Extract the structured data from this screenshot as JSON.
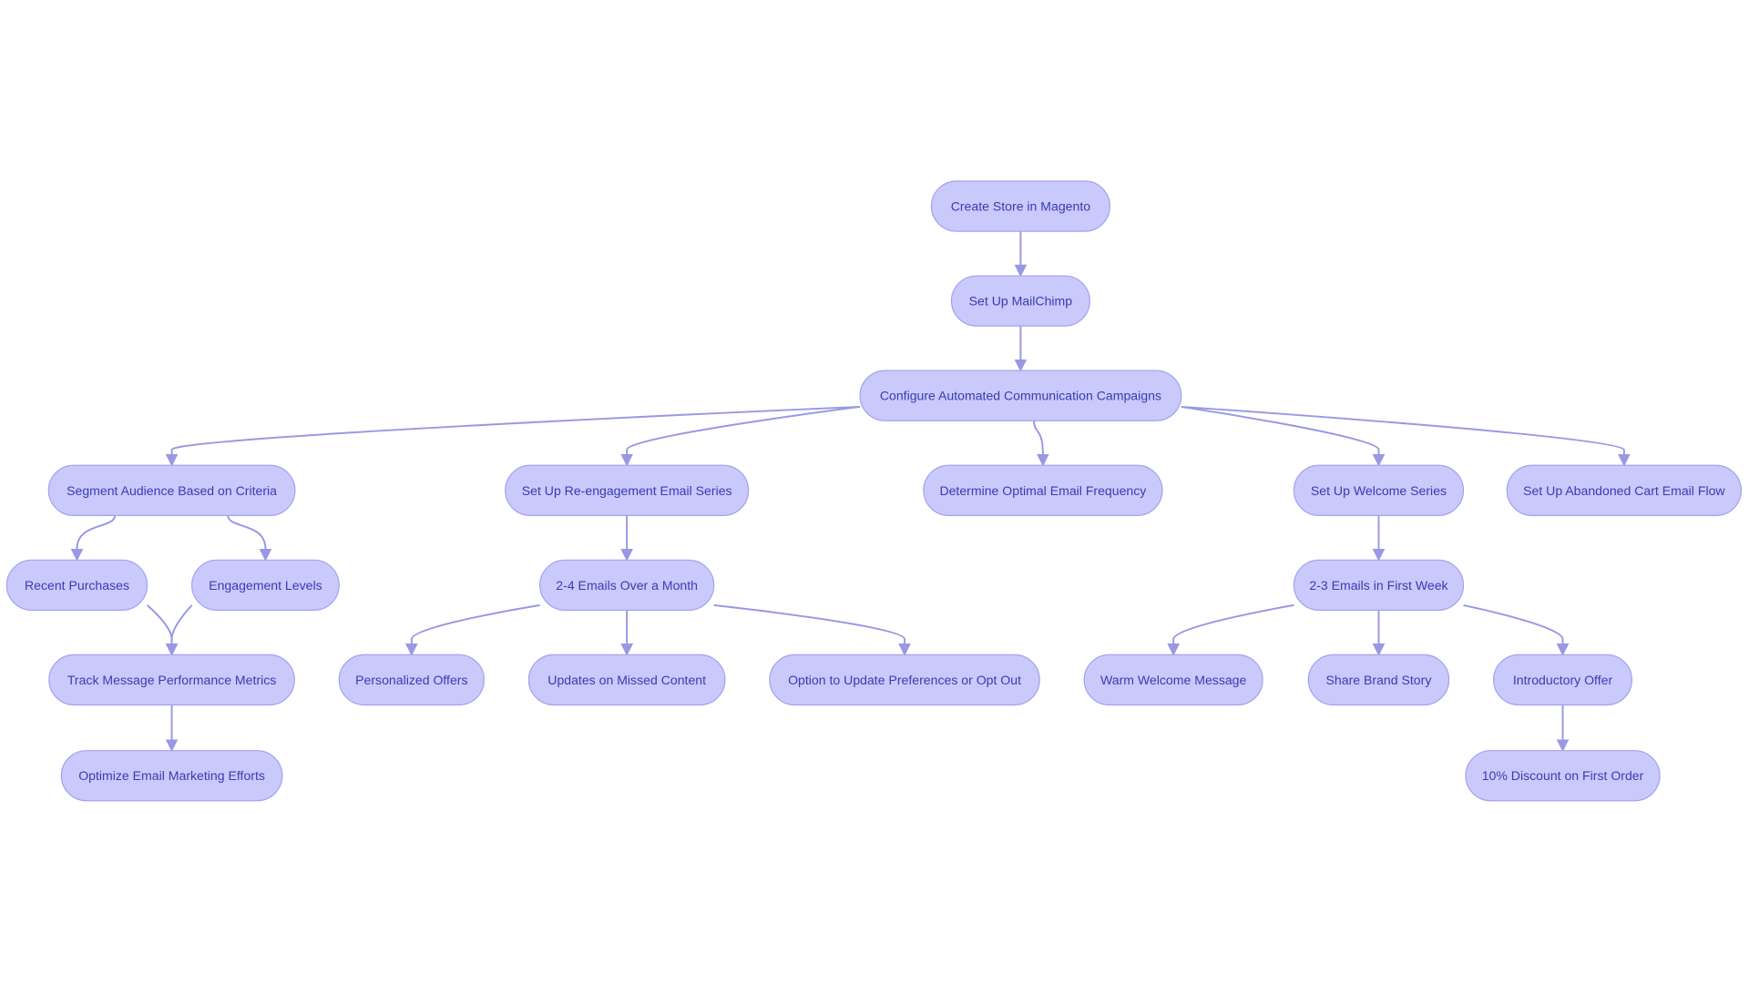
{
  "diagram": {
    "type": "flowchart",
    "colors": {
      "node_fill": "#c9c9fb",
      "node_stroke": "#a3a3ee",
      "text": "#3b3bb3",
      "edge": "#9898e4"
    },
    "nodes": [
      {
        "id": "create_store",
        "label": "Create Store in Magento"
      },
      {
        "id": "mailchimp",
        "label": "Set Up MailChimp"
      },
      {
        "id": "configure",
        "label": "Configure Automated Communication Campaigns"
      },
      {
        "id": "segment",
        "label": "Segment Audience Based on Criteria"
      },
      {
        "id": "reengage",
        "label": "Set Up Re-engagement Email Series"
      },
      {
        "id": "frequency",
        "label": "Determine Optimal Email Frequency"
      },
      {
        "id": "welcome",
        "label": "Set Up Welcome Series"
      },
      {
        "id": "abandoned",
        "label": "Set Up Abandoned Cart Email Flow"
      },
      {
        "id": "recent",
        "label": "Recent Purchases"
      },
      {
        "id": "engagement",
        "label": "Engagement Levels"
      },
      {
        "id": "emails24",
        "label": "2-4 Emails Over a Month"
      },
      {
        "id": "emails23",
        "label": "2-3 Emails in First Week"
      },
      {
        "id": "track",
        "label": "Track Message Performance Metrics"
      },
      {
        "id": "personalized",
        "label": "Personalized Offers"
      },
      {
        "id": "updates",
        "label": "Updates on Missed Content"
      },
      {
        "id": "option",
        "label": "Option to Update Preferences or Opt Out"
      },
      {
        "id": "warm",
        "label": "Warm Welcome Message"
      },
      {
        "id": "brand",
        "label": "Share Brand Story"
      },
      {
        "id": "intro",
        "label": "Introductory Offer"
      },
      {
        "id": "optimize",
        "label": "Optimize Email Marketing Efforts"
      },
      {
        "id": "discount",
        "label": "10% Discount on First Order"
      }
    ],
    "edges": [
      [
        "create_store",
        "mailchimp"
      ],
      [
        "mailchimp",
        "configure"
      ],
      [
        "configure",
        "segment"
      ],
      [
        "configure",
        "reengage"
      ],
      [
        "configure",
        "frequency"
      ],
      [
        "configure",
        "welcome"
      ],
      [
        "configure",
        "abandoned"
      ],
      [
        "segment",
        "recent"
      ],
      [
        "segment",
        "engagement"
      ],
      [
        "recent",
        "track"
      ],
      [
        "engagement",
        "track"
      ],
      [
        "track",
        "optimize"
      ],
      [
        "reengage",
        "emails24"
      ],
      [
        "emails24",
        "personalized"
      ],
      [
        "emails24",
        "updates"
      ],
      [
        "emails24",
        "option"
      ],
      [
        "welcome",
        "emails23"
      ],
      [
        "emails23",
        "warm"
      ],
      [
        "emails23",
        "brand"
      ],
      [
        "emails23",
        "intro"
      ],
      [
        "intro",
        "discount"
      ]
    ]
  }
}
